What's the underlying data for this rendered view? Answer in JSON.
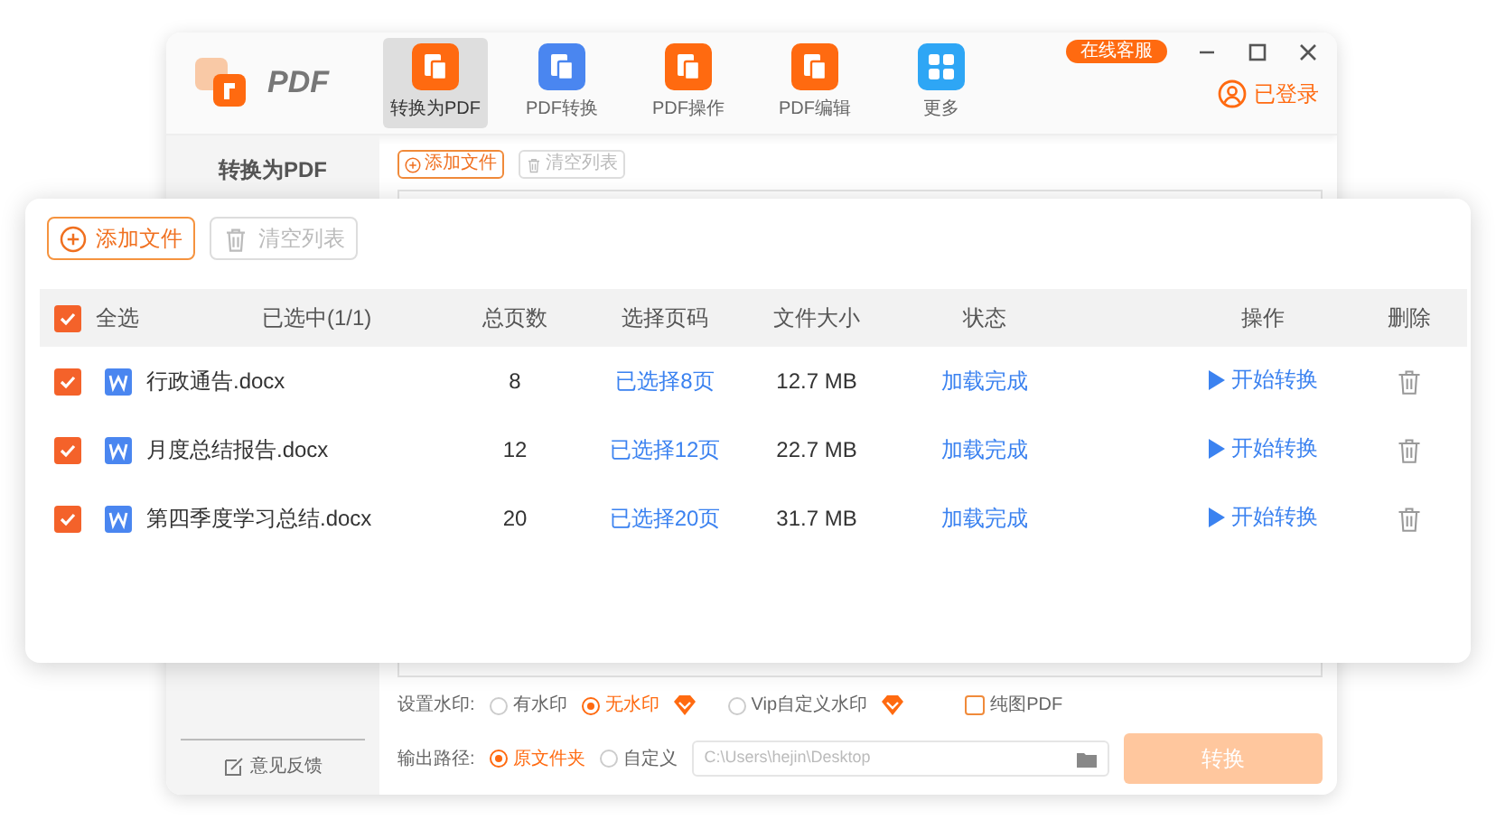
{
  "app": {
    "logo_text": "PDF",
    "nav": [
      {
        "label": "转换为PDF",
        "selected": true,
        "kind": "document",
        "color": "#ff6a10"
      },
      {
        "label": "PDF转换",
        "selected": false,
        "kind": "document",
        "color": "#4a86f0"
      },
      {
        "label": "PDF操作",
        "selected": false,
        "kind": "document",
        "color": "#ff6a10"
      },
      {
        "label": "PDF编辑",
        "selected": false,
        "kind": "document",
        "color": "#ff6a10"
      },
      {
        "label": "更多",
        "selected": false,
        "kind": "grid",
        "color": "#2ea6f5"
      }
    ],
    "support_badge": "在线客服",
    "login": "已登录",
    "sidebar": {
      "title": "转换为PDF",
      "feedback": "意见反馈"
    },
    "toolbar": {
      "add": "添加文件",
      "clear": "清空列表"
    },
    "watermark_label": "设置水印:",
    "watermark_options": [
      {
        "label": "有水印",
        "selected": false,
        "vip": false
      },
      {
        "label": "无水印",
        "selected": true,
        "vip": true
      },
      {
        "label": "Vip自定义水印",
        "selected": false,
        "vip": true
      }
    ],
    "pure_pdf": {
      "label": "纯图PDF",
      "checked": false
    },
    "output_label": "输出路径:",
    "output_options": [
      {
        "label": "原文件夹",
        "selected": true
      },
      {
        "label": "自定义",
        "selected": false
      }
    ],
    "output_path": "C:\\Users\\hejin\\Desktop",
    "convert_button": "转换"
  },
  "file_panel": {
    "add_button": "添加文件",
    "clear_button": "清空列表",
    "header": {
      "select_all_checked": true,
      "select_all": "全选",
      "selected_count": "已选中(1/1)",
      "columns": [
        "总页数",
        "选择页码",
        "文件大小",
        "状态",
        "操作",
        "删除"
      ]
    },
    "rows": [
      {
        "checked": true,
        "name": "行政通告.docx",
        "pages": "8",
        "page_selection": "已选择8页",
        "size": "12.7 MB",
        "status": "加载完成",
        "action": "开始转换"
      },
      {
        "checked": true,
        "name": "月度总结报告.docx",
        "pages": "12",
        "page_selection": "已选择12页",
        "size": "22.7 MB",
        "status": "加载完成",
        "action": "开始转换"
      },
      {
        "checked": true,
        "name": "第四季度学习总结.docx",
        "pages": "20",
        "page_selection": "已选择20页",
        "size": "31.7 MB",
        "status": "加载完成",
        "action": "开始转换"
      }
    ]
  }
}
